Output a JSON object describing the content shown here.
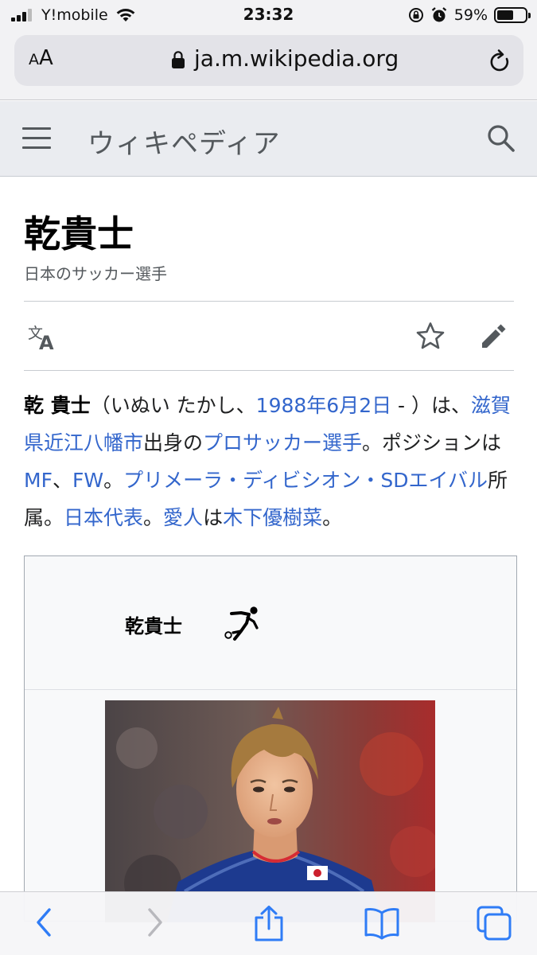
{
  "status_bar": {
    "carrier": "Y!mobile",
    "time": "23:32",
    "battery_percent": "59%",
    "battery_level": 0.59
  },
  "browser": {
    "text_size_label": "AA",
    "url": "ja.m.wikipedia.org"
  },
  "wiki": {
    "logo_text": "ウィキペディア"
  },
  "article": {
    "title": "乾貴士",
    "subtitle": "日本のサッカー選手",
    "lead": {
      "bold_name": "乾 貴士",
      "reading": "（いぬい たかし、",
      "birth_link": "1988年6月2日",
      "after_birth": " - ）は、",
      "birthplace_link": "滋賀県近江八幡市",
      "birthplace_suffix": "出身の",
      "profession_link": "プロサッカー選手",
      "position_text": "。ポジションは",
      "pos_mf": "MF",
      "comma": "、",
      "pos_fw": "FW",
      "period1": "。",
      "club_link": "プリメーラ・ディビシオン・SDエイバル",
      "club_suffix": "所属。",
      "national_link": "日本代表",
      "period2": "。",
      "partner_link": "愛人",
      "partner_mid": "は",
      "partner_name_link": "木下優樹菜",
      "period3": "。"
    }
  },
  "infobox": {
    "name": "乾貴士"
  },
  "toolbar": {
    "icons": [
      "back-icon",
      "forward-icon",
      "share-icon",
      "bookmarks-icon",
      "tabs-icon"
    ]
  },
  "colors": {
    "link": "#3366cc",
    "ios_blue": "#2f7cf6",
    "header_bg": "#eaecf0"
  }
}
